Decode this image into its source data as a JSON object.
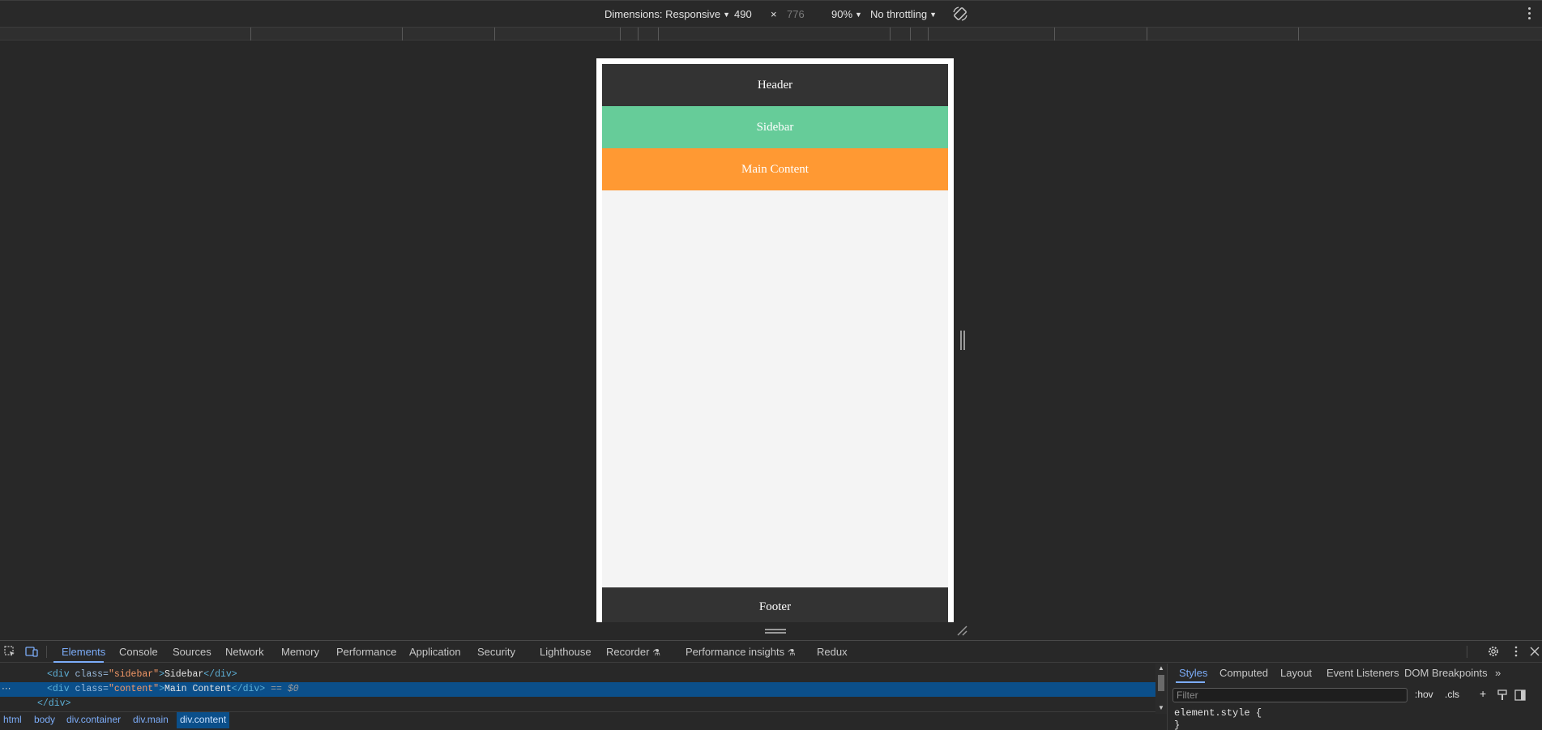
{
  "device_toolbar": {
    "dimensions_label": "Dimensions: Responsive",
    "width": "490",
    "times": "×",
    "height": "776",
    "zoom": "90%",
    "throttling": "No throttling"
  },
  "viewport": {
    "header": "Header",
    "sidebar": "Sidebar",
    "content": "Main Content",
    "footer": "Footer"
  },
  "devtools": {
    "tabs": [
      "Elements",
      "Console",
      "Sources",
      "Network",
      "Memory",
      "Performance",
      "Application",
      "Security",
      "Lighthouse",
      "Recorder",
      "Performance insights",
      "Redux"
    ],
    "active_tab": "Elements",
    "code": {
      "line1": {
        "open_tag": "<div ",
        "attr": "class=",
        "value": "\"sidebar\"",
        "close": ">",
        "text": "Sidebar",
        "end_tag": "</div>"
      },
      "line2": {
        "open_tag": "<div ",
        "attr": "class=",
        "value": "\"content\"",
        "close": ">",
        "text": "Main Content",
        "end_tag": "</div>",
        "marker": " == $0"
      },
      "line3": {
        "end_tag": "</div>"
      }
    },
    "breadcrumbs": [
      "html",
      "body",
      "div.container",
      "div.main",
      "div.content"
    ],
    "styles_tabs": [
      "Styles",
      "Computed",
      "Layout",
      "Event Listeners",
      "DOM Breakpoints"
    ],
    "filter_placeholder": "Filter",
    "hov": ":hov",
    "cls": ".cls",
    "element_style": "element.style {\n}"
  },
  "colors": {
    "header_bg": "#333333",
    "sidebar_bg": "#66cc99",
    "content_bg": "#ff9933",
    "page_bg": "#f4f4f4",
    "accent": "#7cacf8",
    "selection": "#0b4f8a"
  }
}
